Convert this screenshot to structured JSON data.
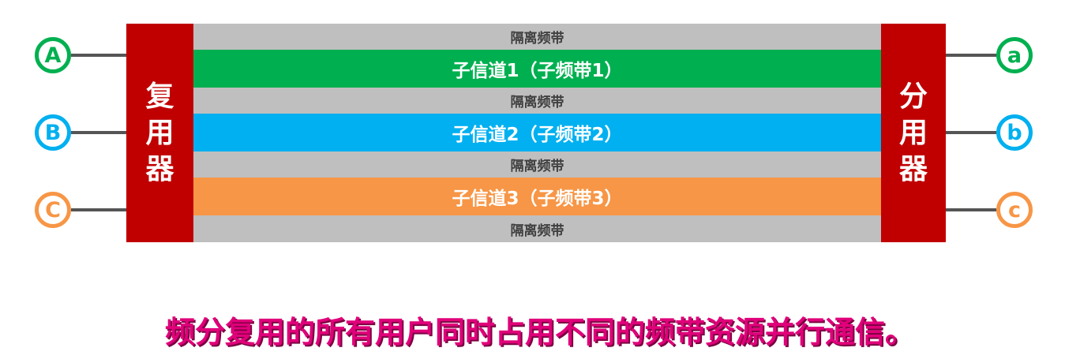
{
  "inputs": [
    {
      "label": "A",
      "color": "#00b050"
    },
    {
      "label": "B",
      "color": "#00b0f0"
    },
    {
      "label": "C",
      "color": "#f79646"
    }
  ],
  "outputs": [
    {
      "label": "a",
      "color": "#00b050"
    },
    {
      "label": "b",
      "color": "#00b0f0"
    },
    {
      "label": "c",
      "color": "#f79646"
    }
  ],
  "multiplexer": {
    "chars": [
      "复",
      "用",
      "器"
    ],
    "color": "#c00000"
  },
  "demultiplexer": {
    "chars": [
      "分",
      "用",
      "器"
    ],
    "color": "#c00000"
  },
  "guard_band_label": "隔离频带",
  "guard_band_color": "#bfbfbf",
  "channels": [
    {
      "label": "子信道1（子频带1）",
      "color": "#00b050"
    },
    {
      "label": "子信道2（子频带2）",
      "color": "#00b0f0"
    },
    {
      "label": "子信道3（子频带3）",
      "color": "#f79646"
    }
  ],
  "caption": "频分复用的所有用户同时占用不同的频带资源并行通信。"
}
